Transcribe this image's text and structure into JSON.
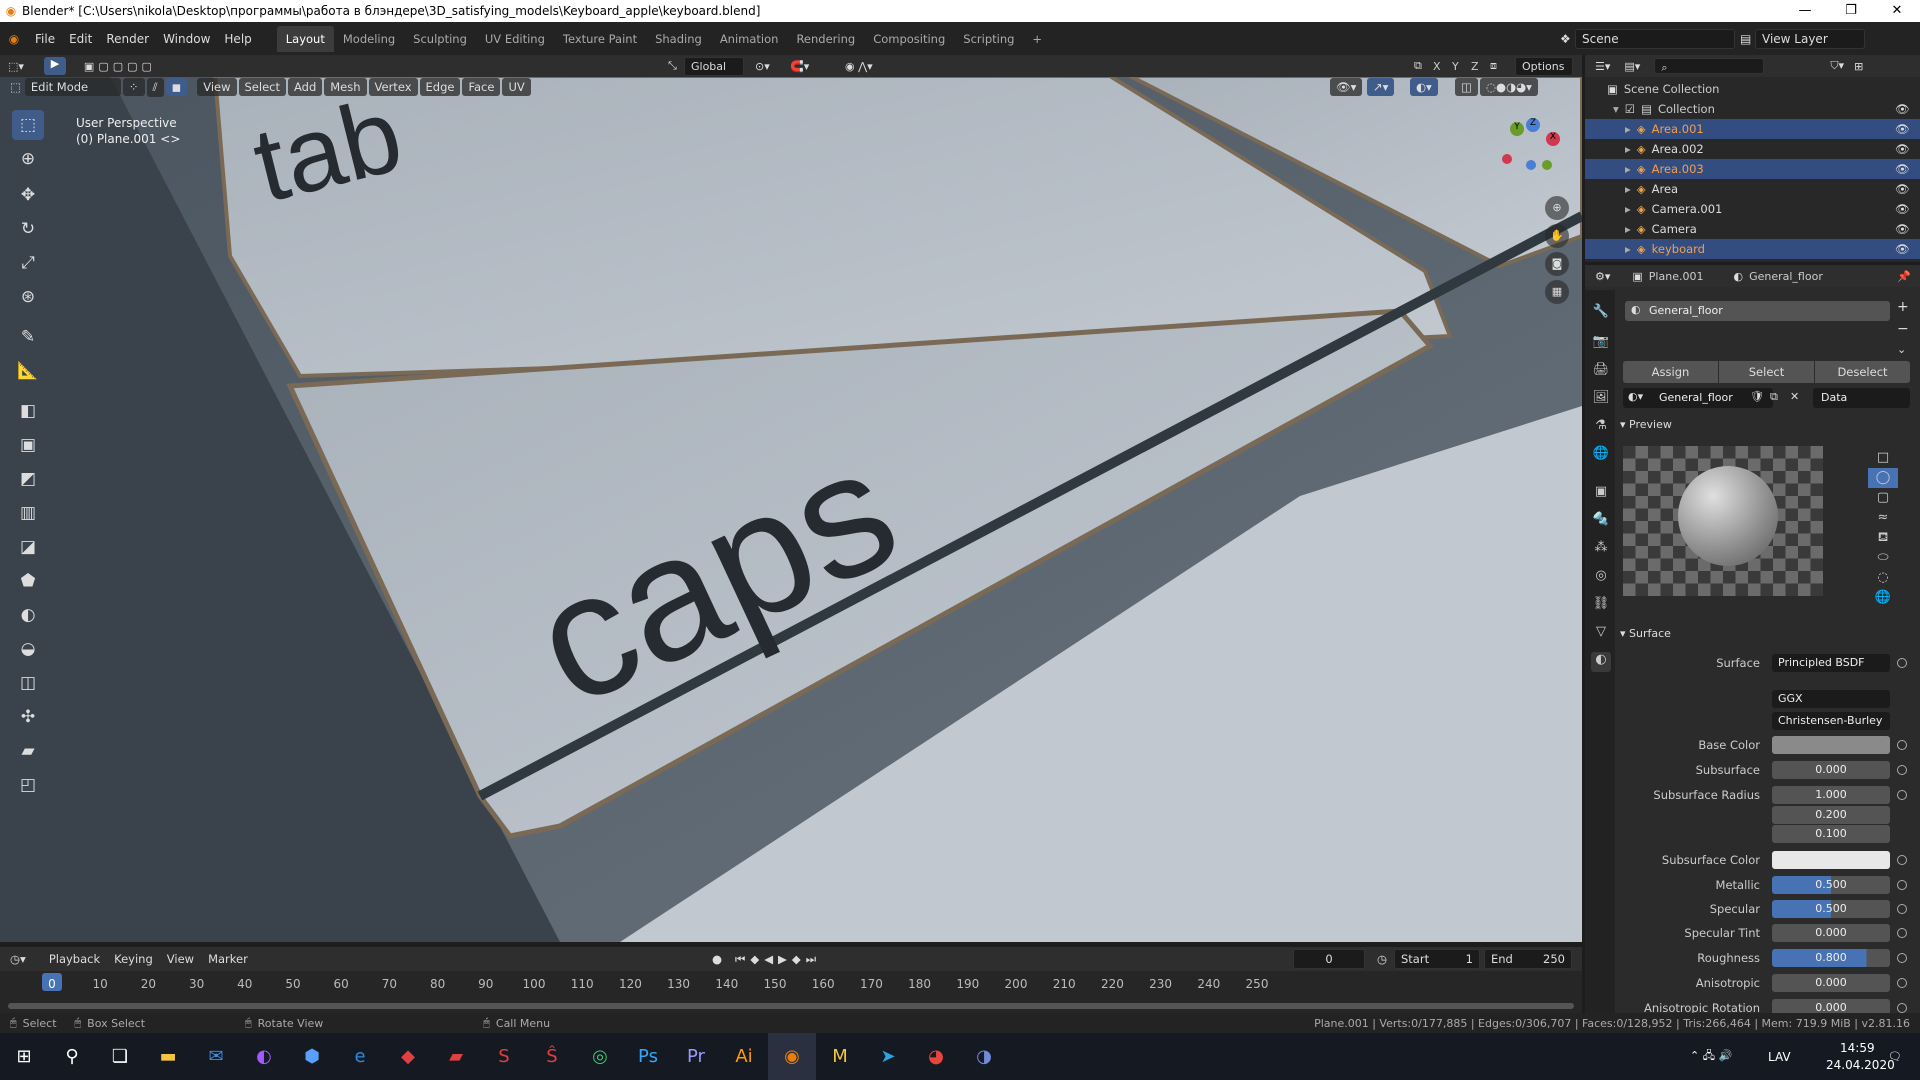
{
  "window": {
    "title": "Blender* [C:\\Users\\nikola\\Desktop\\программы\\работа в блэндере\\3D_satisfying_models\\Keyboard_apple\\keyboard.blend]",
    "minimize": "—",
    "maximize": "❐",
    "close": "✕"
  },
  "menu": [
    "File",
    "Edit",
    "Render",
    "Window",
    "Help"
  ],
  "workspaces": [
    "Layout",
    "Modeling",
    "Sculpting",
    "UV Editing",
    "Texture Paint",
    "Shading",
    "Animation",
    "Rendering",
    "Compositing",
    "Scripting"
  ],
  "workspace_add": "+",
  "scene": {
    "label": "Scene",
    "view_layer": "View Layer"
  },
  "viewport": {
    "mode": "Edit Mode",
    "menus": [
      "View",
      "Select",
      "Add",
      "Mesh",
      "Vertex",
      "Edge",
      "Face",
      "UV"
    ],
    "orientation": "Global",
    "options": "Options",
    "axes": [
      "X",
      "Y",
      "Z"
    ],
    "perspective": "User Perspective",
    "object_info": "(0) Plane.001 <>",
    "key_labels": [
      "tab",
      "caps"
    ]
  },
  "gizmo": {
    "y": "Y",
    "z": "Z",
    "x": "X"
  },
  "outliner": {
    "root": "Scene Collection",
    "collection": "Collection",
    "items": [
      {
        "name": "Area.001",
        "selected": true
      },
      {
        "name": "Area.002",
        "selected": false
      },
      {
        "name": "Area.003",
        "selected": true
      },
      {
        "name": "Area",
        "selected": false
      },
      {
        "name": "Camera.001",
        "selected": false
      },
      {
        "name": "Camera",
        "selected": false
      },
      {
        "name": "keyboard",
        "selected": true
      }
    ]
  },
  "properties": {
    "object": "Plane.001",
    "material": "General_floor",
    "slot": "General_floor",
    "buttons": [
      "Assign",
      "Select",
      "Deselect"
    ],
    "link": "Data",
    "preview_label": "Preview",
    "surface_label": "Surface",
    "fields": [
      {
        "label": "Surface",
        "value": "Principled BSDF"
      },
      {
        "label": "",
        "value": "GGX"
      },
      {
        "label": "",
        "value": "Christensen-Burley"
      },
      {
        "label": "Base Color",
        "value": ""
      },
      {
        "label": "Subsurface",
        "value": "0.000"
      },
      {
        "label": "Subsurface Radius",
        "value": "1.000"
      },
      {
        "label": "",
        "value": "0.200"
      },
      {
        "label": "",
        "value": "0.100"
      },
      {
        "label": "Subsurface Color",
        "value": ""
      },
      {
        "label": "Metallic",
        "value": "0.500",
        "fill": 0.5
      },
      {
        "label": "Specular",
        "value": "0.500",
        "fill": 0.5
      },
      {
        "label": "Specular Tint",
        "value": "0.000"
      },
      {
        "label": "Roughness",
        "value": "0.800",
        "fill": 0.8
      },
      {
        "label": "Anisotropic",
        "value": "0.000"
      },
      {
        "label": "Anisotropic Rotation",
        "value": "0.000"
      }
    ]
  },
  "timeline": {
    "menus": [
      "Playback",
      "Keying",
      "View",
      "Marker"
    ],
    "current_frame": "0",
    "start_label": "Start",
    "start": "1",
    "end_label": "End",
    "end": "250",
    "ticks": [
      "0",
      "10",
      "20",
      "30",
      "40",
      "50",
      "60",
      "70",
      "80",
      "90",
      "100",
      "110",
      "120",
      "130",
      "140",
      "150",
      "160",
      "170",
      "180",
      "190",
      "200",
      "210",
      "220",
      "230",
      "240",
      "250"
    ]
  },
  "status": {
    "select": "Select",
    "box_select": "Box Select",
    "rotate": "Rotate View",
    "call_menu": "Call Menu",
    "stats": "Plane.001 | Verts:0/177,885 | Edges:0/306,707 | Faces:0/128,952 | Tris:266,464 | Mem: 719.9 MiB | v2.81.16"
  },
  "taskbar": {
    "lang": "LAV",
    "time": "14:59",
    "date": "24.04.2020"
  }
}
